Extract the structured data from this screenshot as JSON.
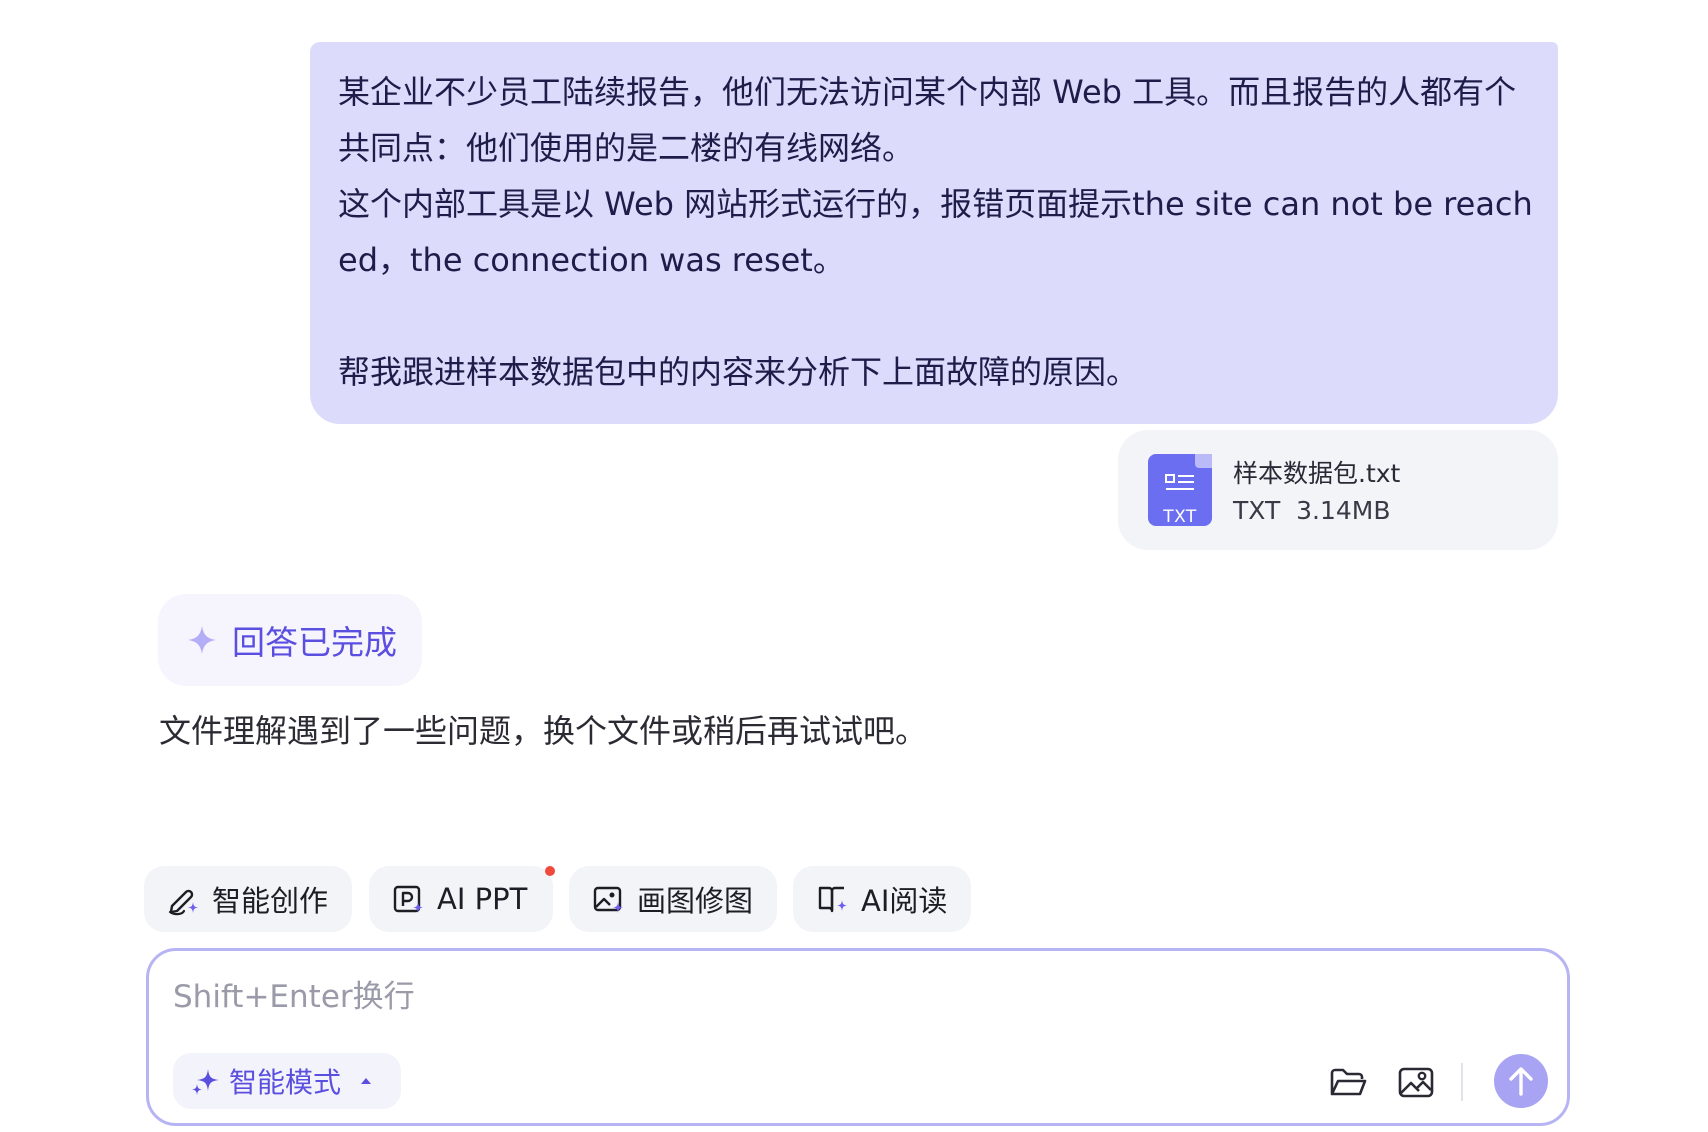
{
  "user_message": {
    "text": "某企业不少员工陆续报告，他们无法访问某个内部 Web 工具。而且报告的人都有个共同点：他们使用的是二楼的有线网络。\n这个内部工具是以 Web 网站形式运行的，报错页面提示the site can not be reached，the connection was reset。\n\n帮我跟进样本数据包中的内容来分析下上面故障的原因。"
  },
  "attachment": {
    "icon_label": "TXT",
    "file_name": "样本数据包.txt",
    "file_meta": "TXT  3.14MB",
    "icon_color": "#6c6ef2"
  },
  "answer": {
    "status": "回答已完成",
    "text": "文件理解遇到了一些问题，换个文件或稍后再试试吧。"
  },
  "tools": [
    {
      "label": "智能创作",
      "icon": "pen-sparkle-icon"
    },
    {
      "label": "AI PPT",
      "icon": "ppt-icon"
    },
    {
      "label": "画图修图",
      "icon": "image-edit-icon"
    },
    {
      "label": "AI阅读",
      "icon": "book-read-icon"
    }
  ],
  "input": {
    "placeholder": "Shift+Enter换行",
    "value": "",
    "mode_label": "智能模式"
  },
  "colors": {
    "accent": "#5b4fe0",
    "user_bubble": "#dcdbfb",
    "send_button": "#a8a3f2",
    "notification_dot": "#f04a3c"
  }
}
